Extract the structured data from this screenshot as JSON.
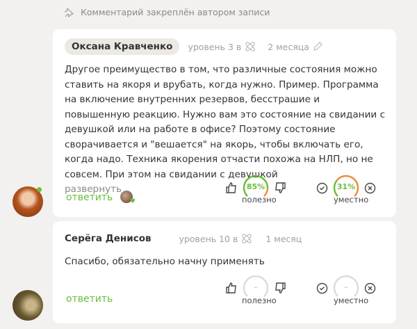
{
  "pinned": {
    "text": "Комментарий закреплён автором записи"
  },
  "comments": [
    {
      "author": "Оксана Кравченко",
      "level": "уровень 3 в",
      "time": "2 месяца",
      "text": "Другое преимущество в том, что различные состояния можно ставить на якоря и врубать, когда нужно. Пример. Программа на включение внутренних резервов, бесстрашие и повышенную реакцию. Нужно вам это состояние на свидании с девушкой или на работе в офисе? Поэтому состояние сворачивается и \"вешается\" на якорь, чтобы включать его, когда надо. Техника якорения отчасти похожа на НЛП, но не совсем. При этом на свидании с девушкой",
      "expand": "развернуть",
      "reply": "ответить",
      "useful": {
        "value": "85%",
        "fraction": 0.85,
        "label": "полезно"
      },
      "relevant": {
        "value": "31%",
        "fraction": 0.31,
        "label": "уместно"
      }
    },
    {
      "author": "Серёга Денисов",
      "level": "уровень 10 в",
      "time": "1 месяц",
      "text": "Спасибо, обязательно начну применять",
      "reply": "ответить",
      "useful": {
        "value": "–",
        "fraction": 0,
        "label": "полезно"
      },
      "relevant": {
        "value": "–",
        "fraction": 0,
        "label": "уместно"
      }
    }
  ],
  "colors": {
    "green": "#6cbd3c",
    "orange": "#f5893a",
    "gray": "#dcdcdc"
  }
}
